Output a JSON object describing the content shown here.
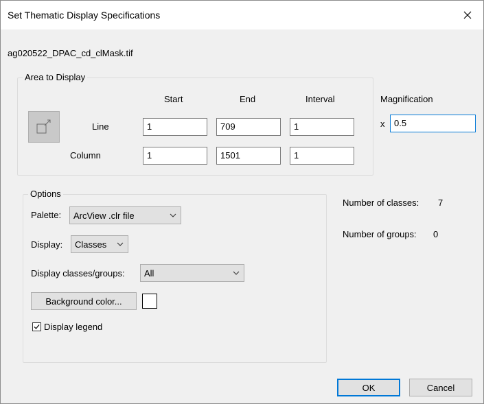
{
  "window": {
    "title": "Set Thematic Display Specifications"
  },
  "file_name": "ag020522_DPAC_cd_clMask.tif",
  "area": {
    "legend": "Area to Display",
    "headers": {
      "start": "Start",
      "end": "End",
      "interval": "Interval"
    },
    "line": {
      "label": "Line",
      "start": "1",
      "end": "709",
      "interval": "1"
    },
    "column": {
      "label": "Column",
      "start": "1",
      "end": "1501",
      "interval": "1"
    }
  },
  "magnification": {
    "label": "Magnification",
    "prefix": "x",
    "value": "0.5"
  },
  "options": {
    "legend": "Options",
    "palette": {
      "label": "Palette:",
      "value": "ArcView .clr file"
    },
    "display": {
      "label": "Display:",
      "value": "Classes"
    },
    "classes_groups": {
      "label": "Display classes/groups:",
      "value": "All"
    },
    "background_button": "Background color...",
    "background_color": "#ffffff",
    "legend_checkbox": {
      "label": "Display legend",
      "checked": true
    }
  },
  "stats": {
    "classes": {
      "label": "Number of classes:",
      "value": "7"
    },
    "groups": {
      "label": "Number of groups:",
      "value": "0"
    }
  },
  "buttons": {
    "ok": "OK",
    "cancel": "Cancel"
  },
  "icons": {
    "close": "close-icon",
    "area": "expand-area-icon",
    "chevron": "chevron-down-icon",
    "check": "checkmark-icon"
  }
}
